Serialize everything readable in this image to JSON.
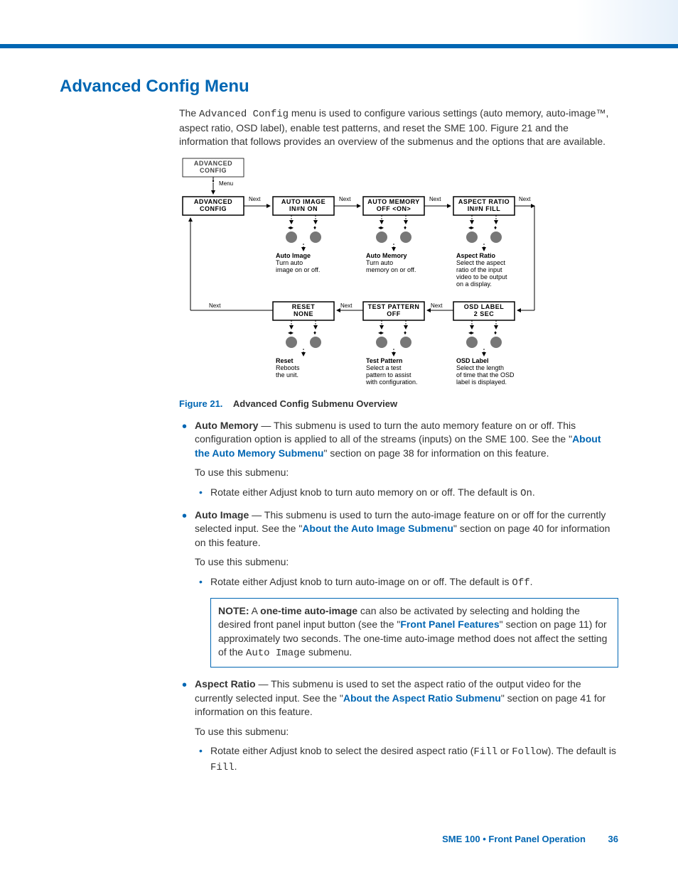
{
  "heading": "Advanced Config Menu",
  "intro": {
    "pre": "The ",
    "mono": "Advanced Config",
    "post": " menu is used to configure various settings (auto memory, auto-image™, aspect ratio, OSD label), enable test patterns, and reset the SME 100. Figure 21 and the information that follows provides an overview of the submenus and the options that are available."
  },
  "diagram": {
    "root": {
      "l1": "ADVANCED",
      "l2": "CONFIG"
    },
    "menu": "Menu",
    "next": "Next",
    "row1": [
      {
        "l1": "ADVANCED",
        "l2": "CONFIG"
      },
      {
        "l1": "AUTO  IMAGE",
        "l2": "IN#N    ON"
      },
      {
        "l1": "AUTO  MEMORY",
        "l2": "OFF   <ON>"
      },
      {
        "l1": "ASPECT  RATIO",
        "l2": "IN#N    FILL"
      }
    ],
    "desc1": [
      {
        "t": "Auto Image",
        "b": [
          "Turn auto",
          "image on or off."
        ]
      },
      {
        "t": "Auto Memory",
        "b": [
          "Turn auto",
          "memory on or off."
        ]
      },
      {
        "t": "Aspect Ratio",
        "b": [
          "Select the aspect",
          "ratio of the input",
          "video to be output",
          "on a display."
        ]
      }
    ],
    "row2": [
      {
        "l1": "RESET",
        "l2": "NONE"
      },
      {
        "l1": "TEST  PATTERN",
        "l2": "OFF"
      },
      {
        "l1": "OSD  LABEL",
        "l2": "2 SEC"
      }
    ],
    "desc2": [
      {
        "t": "Reset",
        "b": [
          "Reboots",
          "the unit."
        ]
      },
      {
        "t": "Test Pattern",
        "b": [
          "Select a test",
          "pattern to assist",
          "with configuration."
        ]
      },
      {
        "t": "OSD Label",
        "b": [
          "Select the length",
          "of time that the OSD",
          "label is displayed."
        ]
      }
    ]
  },
  "figcaption": {
    "num": "Figure 21.",
    "title": "Advanced Config Submenu Overview"
  },
  "bullets": {
    "automem": {
      "lead": "Auto Memory",
      "text1": " — This submenu is used to turn the auto memory feature on or off. This configuration option is applied to all of the streams (inputs) on the SME 100. See the \"",
      "link": "About the Auto Memory Submenu",
      "text2": "\" section on page 38 for information on this feature.",
      "use": "To use this submenu:",
      "sub": "Rotate either Adjust knob to turn auto memory on or off. The default is ",
      "subm": "On",
      "subend": "."
    },
    "autoimg": {
      "lead": "Auto Image",
      "text1": " — This submenu is used to turn the auto-image feature on or off for the currently selected input. See the \"",
      "link": "About the Auto Image Submenu",
      "text2": "\" section on page 40 for information on this feature.",
      "use": "To use this submenu:",
      "sub": "Rotate either Adjust knob to turn auto-image on or off. The default is ",
      "subm": "Off",
      "subend": "."
    },
    "note": {
      "label": "NOTE:",
      "t1": "  A ",
      "bold": "one-time auto-image",
      "t2": " can also be activated by selecting and holding the desired front panel input button (see the \"",
      "link": "Front Panel Features",
      "t3": "\" section on page 11) for approximately two seconds. The one-time auto-image method does not affect the setting of the ",
      "mono": "Auto Image",
      "t4": " submenu."
    },
    "aspect": {
      "lead": "Aspect Ratio",
      "text1": " — This submenu is used to set the aspect ratio of the output video for the currently selected input. See the \"",
      "link": "About the Aspect Ratio Submenu",
      "text2": "\" section on page 41 for information on this feature.",
      "use": "To use this submenu:",
      "sub": "Rotate either Adjust knob to select the desired aspect ratio (",
      "m1": "Fill",
      "mid": " or ",
      "m2": "Follow",
      "sub2": "). The default is ",
      "m3": "Fill",
      "subend": "."
    }
  },
  "footer": {
    "left": "SME 100 • Front Panel Operation",
    "right": "36"
  }
}
